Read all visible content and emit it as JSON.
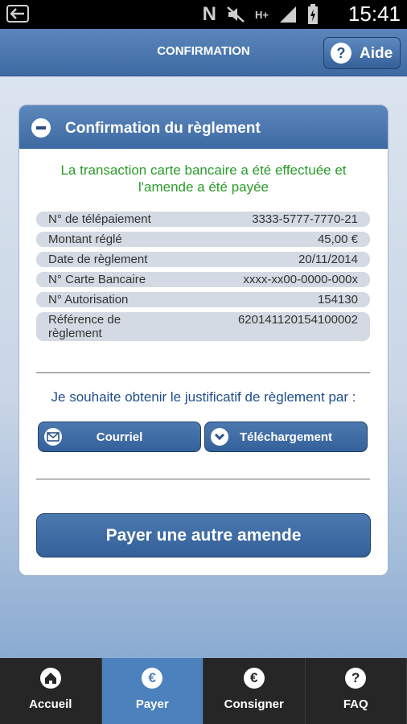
{
  "status_bar": {
    "time": "15:41",
    "network_type": "H+"
  },
  "header": {
    "title": "CONFIRMATION",
    "help_label": "Aide"
  },
  "card": {
    "title": "Confirmation du règlement",
    "success_message_line1": "La transaction carte bancaire a été effectuée et",
    "success_message_line2": "l'amende a été payée",
    "details": [
      {
        "label": "N° de télépaiement",
        "value": "3333-5777-7770-21"
      },
      {
        "label": "Montant réglé",
        "value": "45,00 €"
      },
      {
        "label": "Date de règlement",
        "value": "20/11/2014"
      },
      {
        "label": "N° Carte Bancaire",
        "value": "xxxx-xx00-0000-000x"
      },
      {
        "label": "N° Autorisation",
        "value": "154130"
      },
      {
        "label": "Référence de règlement",
        "value": "620141120154100002"
      }
    ],
    "justificatif_prompt": "Je souhaite obtenir le justificatif de règlement par :",
    "email_button": "Courriel",
    "download_button": "Téléchargement",
    "pay_other_button": "Payer une autre amende"
  },
  "bottom_nav": [
    {
      "label": "Accueil",
      "icon": "home-icon",
      "active": false
    },
    {
      "label": "Payer",
      "icon": "euro-icon",
      "active": true
    },
    {
      "label": "Consigner",
      "icon": "euro-icon",
      "active": false
    },
    {
      "label": "FAQ",
      "icon": "question-icon",
      "active": false
    }
  ],
  "colors": {
    "brand_blue": "#3e6aa3",
    "success_green": "#2a9b2a",
    "active_tab": "#4b81bd"
  }
}
